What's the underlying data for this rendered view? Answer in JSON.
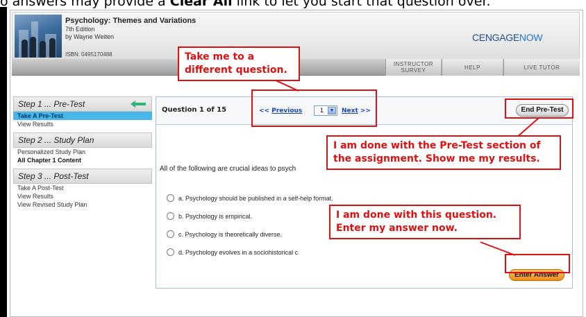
{
  "top_line": {
    "prefix": "o answers may provide a ",
    "bold": "Clear All",
    "suffix": " link to let you start that question over."
  },
  "book": {
    "title": "Psychology: Themes and Variations",
    "edition": "7th Edition",
    "author": "by Wayne Weiten",
    "isbn": "ISBN: 0495170488"
  },
  "logo": {
    "part1": "CENGAGE",
    "part2": "NOW"
  },
  "nav": {
    "instructor_survey": "Instructor Survey",
    "help": "Help",
    "live_tutor": "Live Tutor"
  },
  "sidebar": {
    "step1": {
      "title": "Step 1 ... Pre-Test",
      "items": [
        "Take A Pre-Test",
        "View Results"
      ]
    },
    "step2": {
      "title": "Step 2 ... Study Plan",
      "items": [
        "Personalized Study Plan",
        "All Chapter 1 Content"
      ]
    },
    "step3": {
      "title": "Step 3 ... Post-Test",
      "items": [
        "Take A Post-Test",
        "View Results",
        "View Revised Study Plan"
      ]
    }
  },
  "question": {
    "counter": "Question 1 of 15",
    "prev_arrows": "<<",
    "prev_label": "Previous",
    "selected_number": "1",
    "next_label": "Next",
    "next_arrows": ">>",
    "end_button": "End Pre-Test",
    "text": "All of the following are crucial ideas to psych",
    "options": [
      "a. Psychology should be published in a self-help format.",
      "b. Psychology is empirical.",
      "c. Psychology is theoretically diverse.",
      "d. Psychology evolves in a sociohistorical c"
    ],
    "enter_button": "Enter Answer"
  },
  "annotations": {
    "nav_callout": [
      "Take me to a",
      "different question."
    ],
    "end_callout": [
      "I am done with the Pre-Test section of",
      "the assignment. Show me my results."
    ],
    "enter_callout": [
      "I am done with this question.",
      "Enter my answer now."
    ]
  },
  "colors": {
    "annotation_red": "#dd1111",
    "active_item_bg": "#49b6e8",
    "enter_button": "#f08c13",
    "link_blue": "#1a44b8"
  }
}
